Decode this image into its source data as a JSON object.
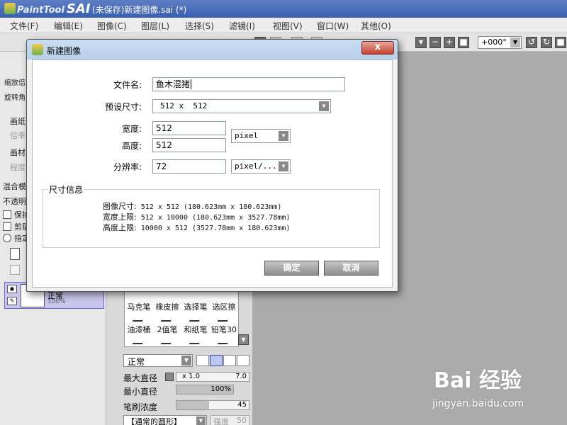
{
  "app": {
    "brand": "PaintTool",
    "brand_bold": "SAI",
    "window_title": "(未保存)新建图像.sai (*)"
  },
  "menu": [
    "文件(F)",
    "编辑(E)",
    "图像(C)",
    "图层(L)",
    "选择(S)",
    "滤镜(I)",
    "视图(V)",
    "窗口(W)",
    "其他(O)"
  ],
  "toolbar": {
    "angle": "+000°"
  },
  "left_panel": {
    "zoom_label": "缩放倍",
    "rotate_label": "旋转角",
    "paper_label": "画纸",
    "paper_value": "倍率",
    "material_label": "画材",
    "material_value": "程度",
    "blend_label": "混合模",
    "opacity_label": "不透明",
    "preserve_label": "保护",
    "clip_label": "剪贴",
    "select_label": "指定",
    "layer_mode": "正常",
    "layer_opacity": "100%"
  },
  "tools": [
    "马克笔",
    "橡皮擦",
    "选择笔",
    "选区擦",
    "油漆桶",
    "2值笔",
    "和纸笔",
    "铅笔30"
  ],
  "brush": {
    "mode": "正常",
    "max_diameter_label": "最大直径",
    "max_diameter_mult": "x 1.0",
    "max_diameter_value": "7.0",
    "min_diameter_label": "最小直径",
    "min_diameter_value": "100%",
    "min_diameter_fraction": 1.0,
    "density_label": "笔刷浓度",
    "density_value": "45",
    "density_fraction": 0.45,
    "shape": "【通常的圆形】",
    "strength_label": "强度",
    "strength_value": "50"
  },
  "dialog": {
    "title": "新建图像",
    "close": "x",
    "filename_label": "文件名:",
    "filename_value": "鱼木混猪",
    "preset_label": "预设尺寸:",
    "preset_value": "512 x  512",
    "width_label": "宽度:",
    "width_value": "512",
    "height_label": "高度:",
    "height_value": "512",
    "unit_value": "pixel",
    "resolution_label": "分辨率:",
    "resolution_value": "72",
    "resolution_unit": "pixel/...",
    "info_title": "尺寸信息",
    "info": [
      {
        "key": "图像尺寸:",
        "value": "512 x 512 (180.623mm x 180.623mm)"
      },
      {
        "key": "宽度上限:",
        "value": "512 x 10000 (180.623mm x 3527.78mm)"
      },
      {
        "key": "高度上限:",
        "value": "10000 x 512 (3527.78mm x 180.623mm)"
      }
    ],
    "ok": "确定",
    "cancel": "取消"
  },
  "watermark": {
    "text": "Bai 经验",
    "url": "jingyan.baidu.com"
  }
}
